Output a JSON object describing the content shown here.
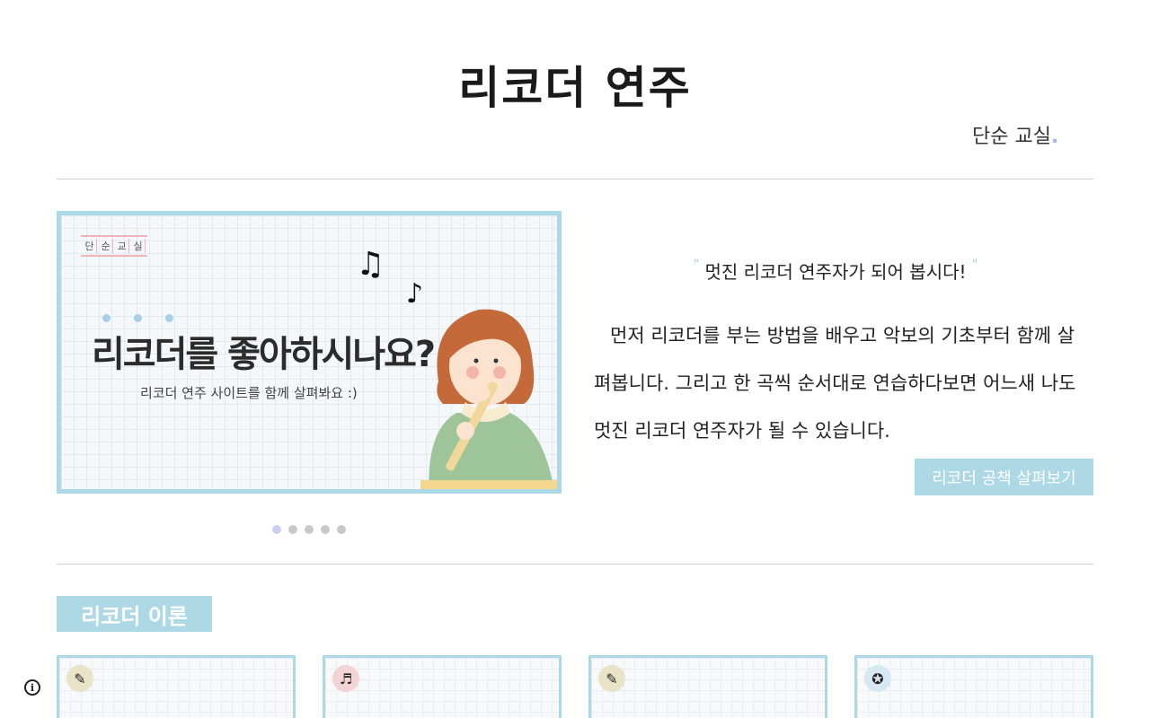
{
  "header": {
    "title": "리코더 연주",
    "subtitle": "단순 교실",
    "subtitle_dot": "."
  },
  "hero": {
    "stamp": [
      "단",
      "순",
      "교",
      "실"
    ],
    "headline": "리코더를 좋아하시나요?",
    "subline": "리코더 연주 사이트를 함께 살펴봐요 :)",
    "note1": "♫",
    "note2": "♪"
  },
  "intro": {
    "quote_open": "\"",
    "quote": "멋진 리코더 연주자가 되어 봅시다!",
    "quote_close": "\"",
    "description": "먼저 리코더를 부는 방법을 배우고 악보의 기초부터 함께 살펴봅니다. 그리고 한 곡씩 순서대로 연습하다보면 어느새 나도 멋진 리코더 연주자가 될 수 있습니다.",
    "cta_label": "리코더 공책 살펴보기"
  },
  "carousel": {
    "slides": 5,
    "active": 0
  },
  "section": {
    "title": "리코더 이론"
  },
  "cards": [
    {
      "badge_icon": "recorder-icon",
      "badge_glyph": "✎",
      "badge_color": "#e9e3c8",
      "glyph": "♪"
    },
    {
      "badge_icon": "sheet-music-icon",
      "badge_glyph": "♬",
      "badge_color": "#f2d3d6",
      "glyph": "𝄞"
    },
    {
      "badge_icon": "recorder-icon",
      "badge_glyph": "✎",
      "badge_color": "#e9e3c8",
      "glyph": "♫"
    },
    {
      "badge_icon": "award-icon",
      "badge_glyph": "✪",
      "badge_color": "#d6e9f3",
      "glyph": "▤"
    }
  ],
  "colors": {
    "accent": "#add8e6",
    "dot_active": "#c7d0f3",
    "dot_inactive": "#c8c8c8"
  },
  "info_icon": "i"
}
